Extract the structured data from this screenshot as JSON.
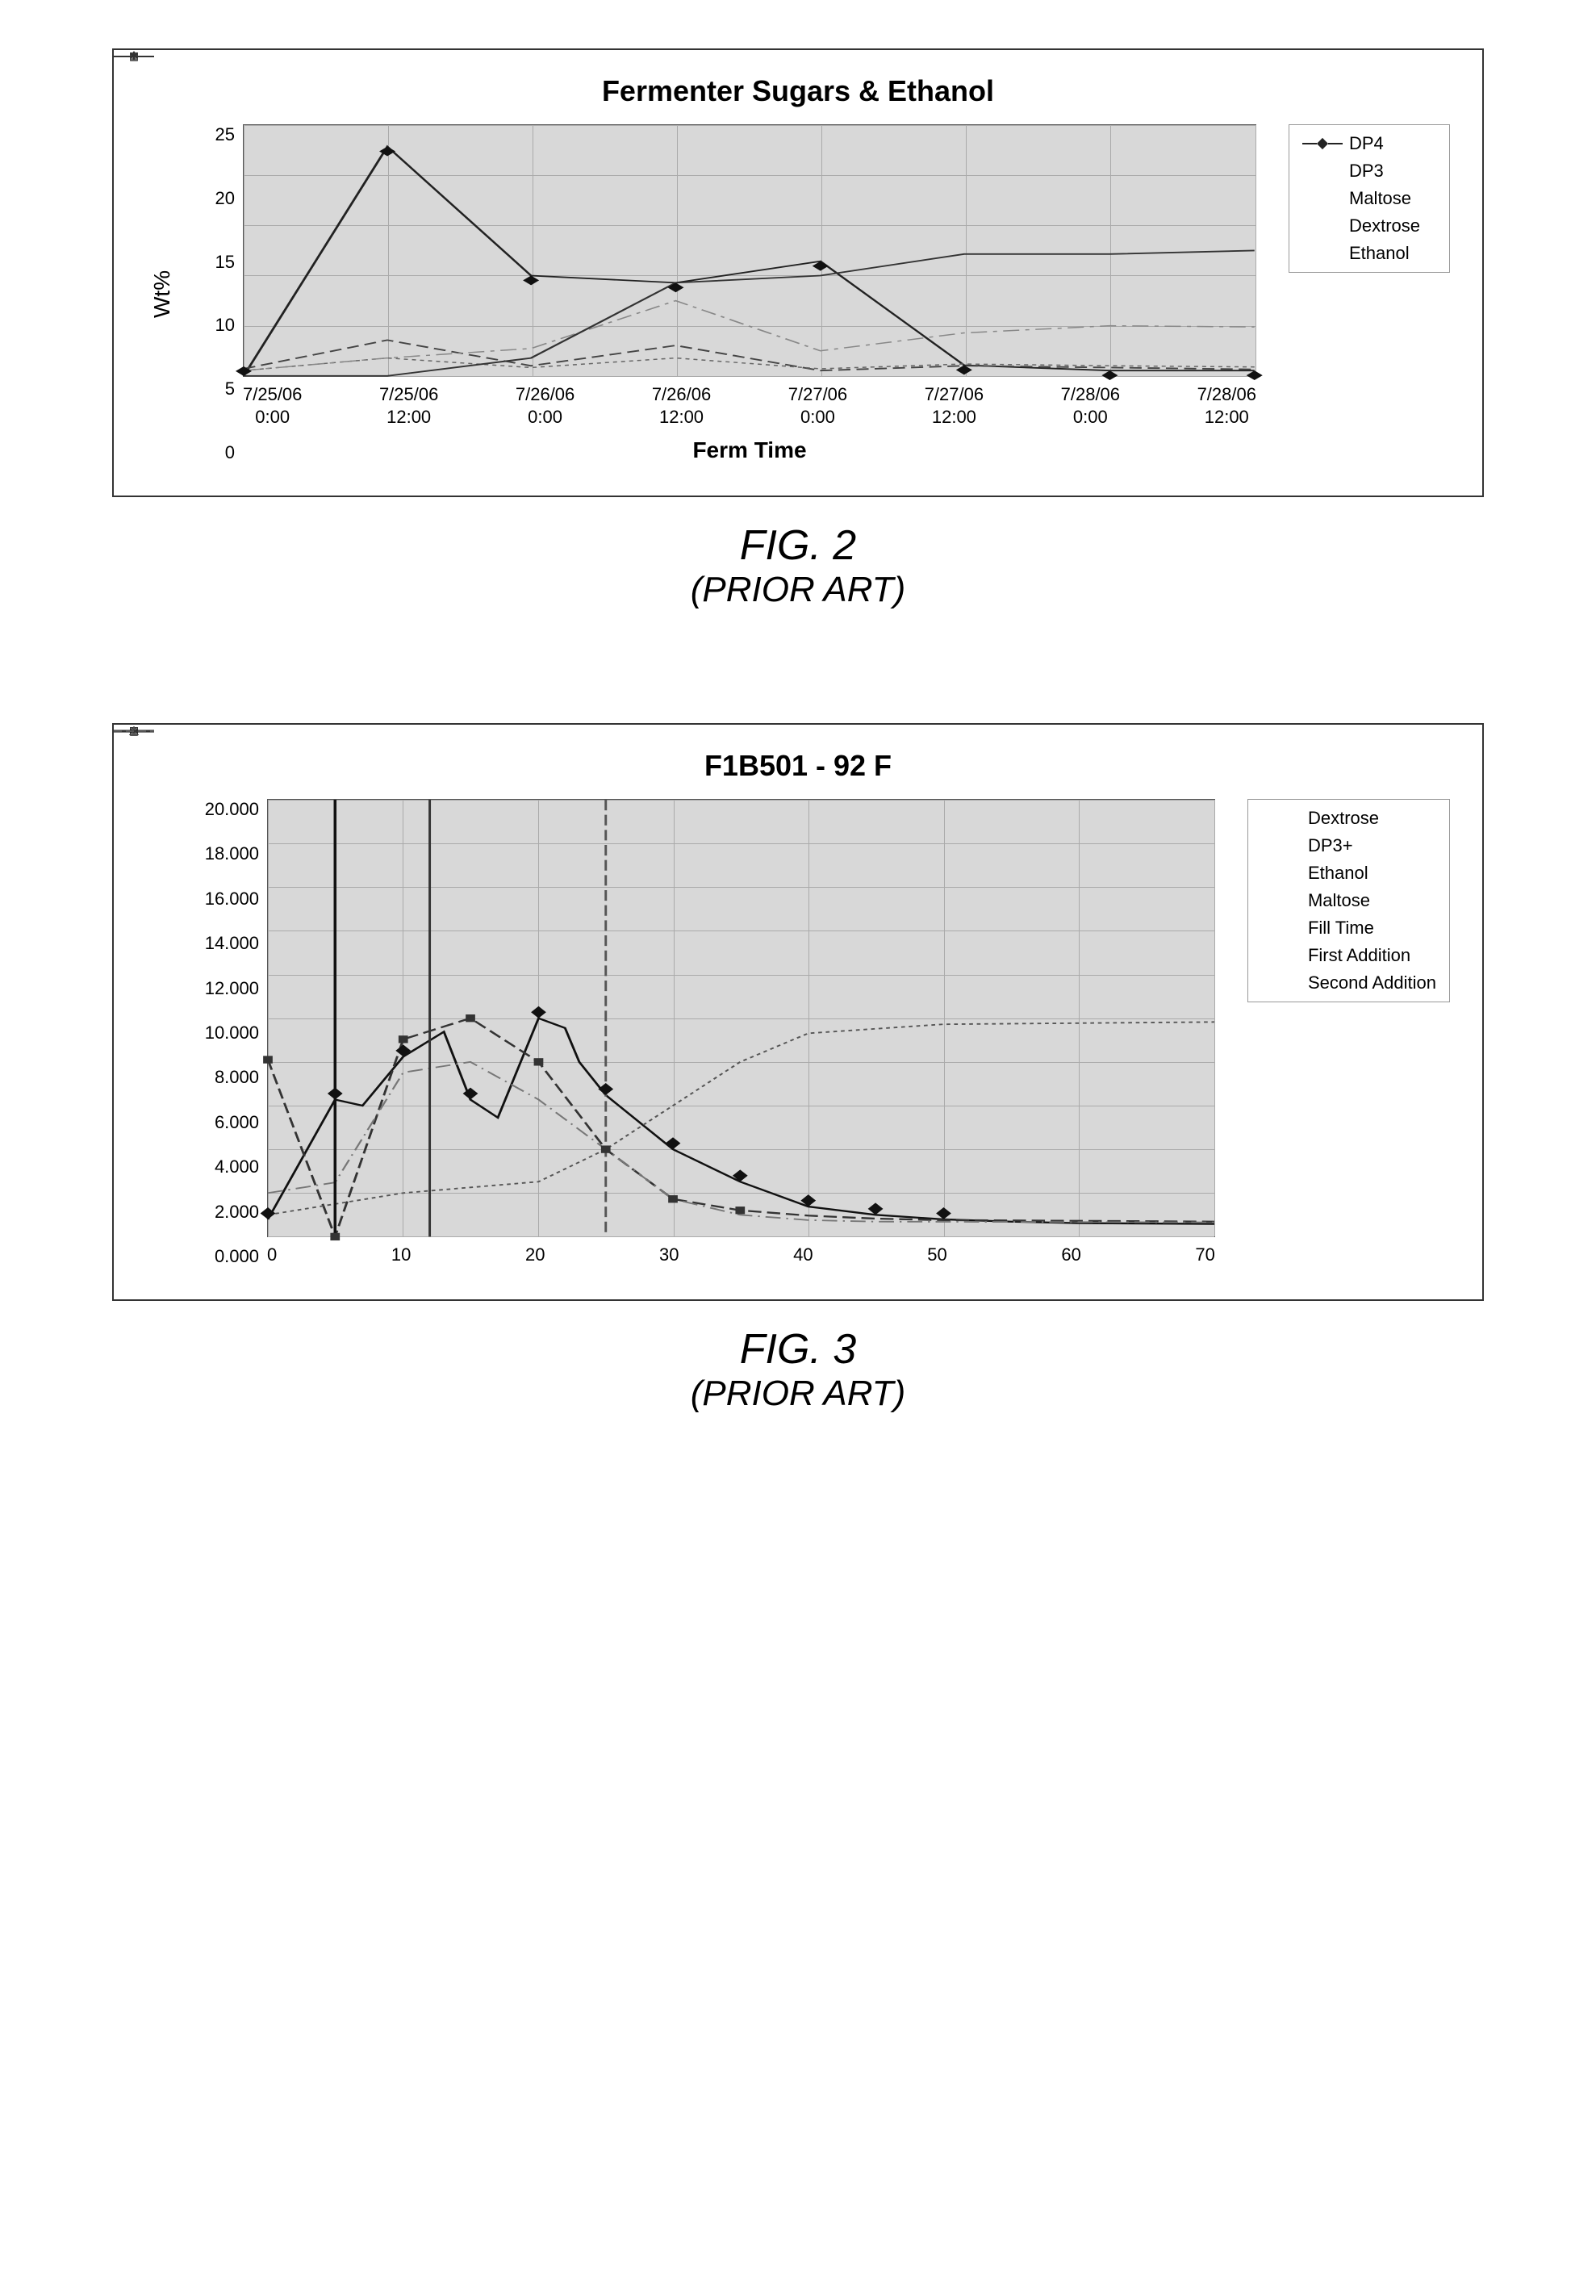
{
  "fig2": {
    "title": "Fermenter Sugars & Ethanol",
    "y_axis_label": "Wt%",
    "x_axis_title": "Ferm Time",
    "y_ticks": [
      "25",
      "20",
      "15",
      "10",
      "5",
      "0"
    ],
    "x_labels": [
      {
        "line1": "7/25/06",
        "line2": "0:00"
      },
      {
        "line1": "7/25/06",
        "line2": "12:00"
      },
      {
        "line1": "7/26/06",
        "line2": "0:00"
      },
      {
        "line1": "7/26/06",
        "line2": "12:00"
      },
      {
        "line1": "7/27/06",
        "line2": "0:00"
      },
      {
        "line1": "7/27/06",
        "line2": "12:00"
      },
      {
        "line1": "7/28/06",
        "line2": "0:00"
      },
      {
        "line1": "7/28/06",
        "line2": "12:00"
      }
    ],
    "legend": [
      {
        "label": "DP4",
        "style": "diamond-solid-line"
      },
      {
        "label": "DP3",
        "style": "square-dashed-line"
      },
      {
        "label": "Maltose",
        "style": "triangle-dotted-line"
      },
      {
        "label": "Dextrose",
        "style": "x-dashed-line"
      },
      {
        "label": "Ethanol",
        "style": "asterisk-solid-line"
      }
    ],
    "caption_number": "FIG. 2",
    "caption_note": "(PRIOR ART)"
  },
  "fig3": {
    "title": "F1B501 - 92 F",
    "y_axis_label": "",
    "x_axis_title": "",
    "y_ticks": [
      "20.000",
      "18.000",
      "16.000",
      "14.000",
      "12.000",
      "10.000",
      "8.000",
      "6.000",
      "4.000",
      "2.000",
      "0.000"
    ],
    "x_labels": [
      "0",
      "10",
      "20",
      "30",
      "40",
      "50",
      "60",
      "70"
    ],
    "legend": [
      {
        "label": "Dextrose",
        "style": "diamond-solid-line"
      },
      {
        "label": "DP3+",
        "style": "square-dashed-line"
      },
      {
        "label": "Ethanol",
        "style": "triangle-dotted-line"
      },
      {
        "label": "Maltose",
        "style": "x-dashed-line"
      },
      {
        "label": "Fill Time",
        "style": "solid-line"
      },
      {
        "label": "First Addition",
        "style": "solid-line-thin"
      },
      {
        "label": "Second Addition",
        "style": "dashed-line"
      }
    ],
    "caption_number": "FIG. 3",
    "caption_note": "(PRIOR ART)"
  }
}
